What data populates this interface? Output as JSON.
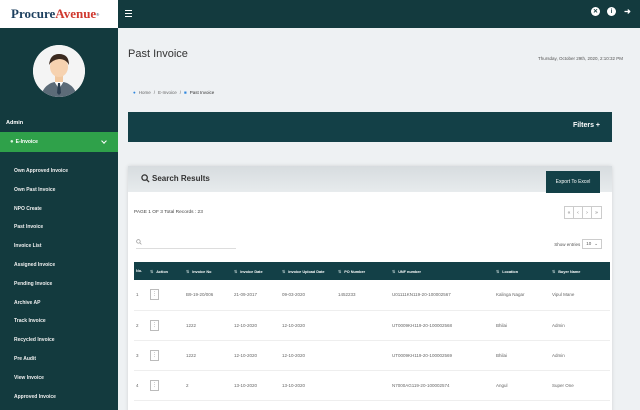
{
  "brand": {
    "part1": "Procure",
    "part2": "Avenue",
    "tm": "®"
  },
  "user": {
    "name": "Admin"
  },
  "sidebar": {
    "active_item": "E-Invoice",
    "items": [
      "Own Approved Invoice",
      "Own Past Invoice",
      "NPO Create",
      "Past Invoice",
      "Invoice List",
      "Assigned Invoice",
      "Pending Invoice",
      "Archive AP",
      "Track Invoice",
      "Recycled Invoice",
      "Pre Audit",
      "View Invoice",
      "Approved Invoice"
    ]
  },
  "topbar": {
    "icons": [
      "close-circle-icon",
      "info-circle-icon",
      "logout-icon"
    ]
  },
  "page": {
    "title": "Past Invoice",
    "datetime": "Thursday, October 29th, 2020, 2:10:32 PM"
  },
  "breadcrumb": {
    "home": "Home",
    "section": "E-Invoice",
    "current": "Past Invoice"
  },
  "filters": {
    "label": "Filters +"
  },
  "results": {
    "title": "Search Results",
    "export_label": "Export To Excel",
    "page_info": "PAGE 1 OF 3 Total Records : 23",
    "search_icon": "🔍",
    "show_entries_label": "Show entries",
    "show_entries_value": "10",
    "pager": [
      "«",
      "‹",
      "›",
      "»"
    ]
  },
  "table": {
    "headers": [
      "No.",
      "Action",
      "Invoice No",
      "Invoice Date",
      "Invoice Upload Date",
      "PO Number",
      "UNF number",
      "Location",
      "Buyer Name"
    ],
    "rows": [
      [
        "1",
        "⋮",
        "B9-19-20/006",
        "21-09-2017",
        "09-03-2020",
        "1452233",
        "U01111KN119-20-100002567",
        "Kalinga Nagar",
        "Vipul Mane"
      ],
      [
        "2",
        "⋮",
        "1222",
        "12-10-2020",
        "12-10-2020",
        "",
        "UT0009KH119-20-100002568",
        "Bhilai",
        "Admin"
      ],
      [
        "3",
        "⋮",
        "1222",
        "12-10-2020",
        "12-10-2020",
        "",
        "UT0009KH119-20-100002569",
        "Bhilai",
        "Admin"
      ],
      [
        "4",
        "⋮",
        "2",
        "13-10-2020",
        "13-10-2020",
        "",
        "N7000AG119-20-100002574",
        "Angul",
        "Super One"
      ]
    ]
  },
  "colors": {
    "sidebar": "#133a3e",
    "active_nav": "#2fa14a",
    "header": "#134047"
  }
}
